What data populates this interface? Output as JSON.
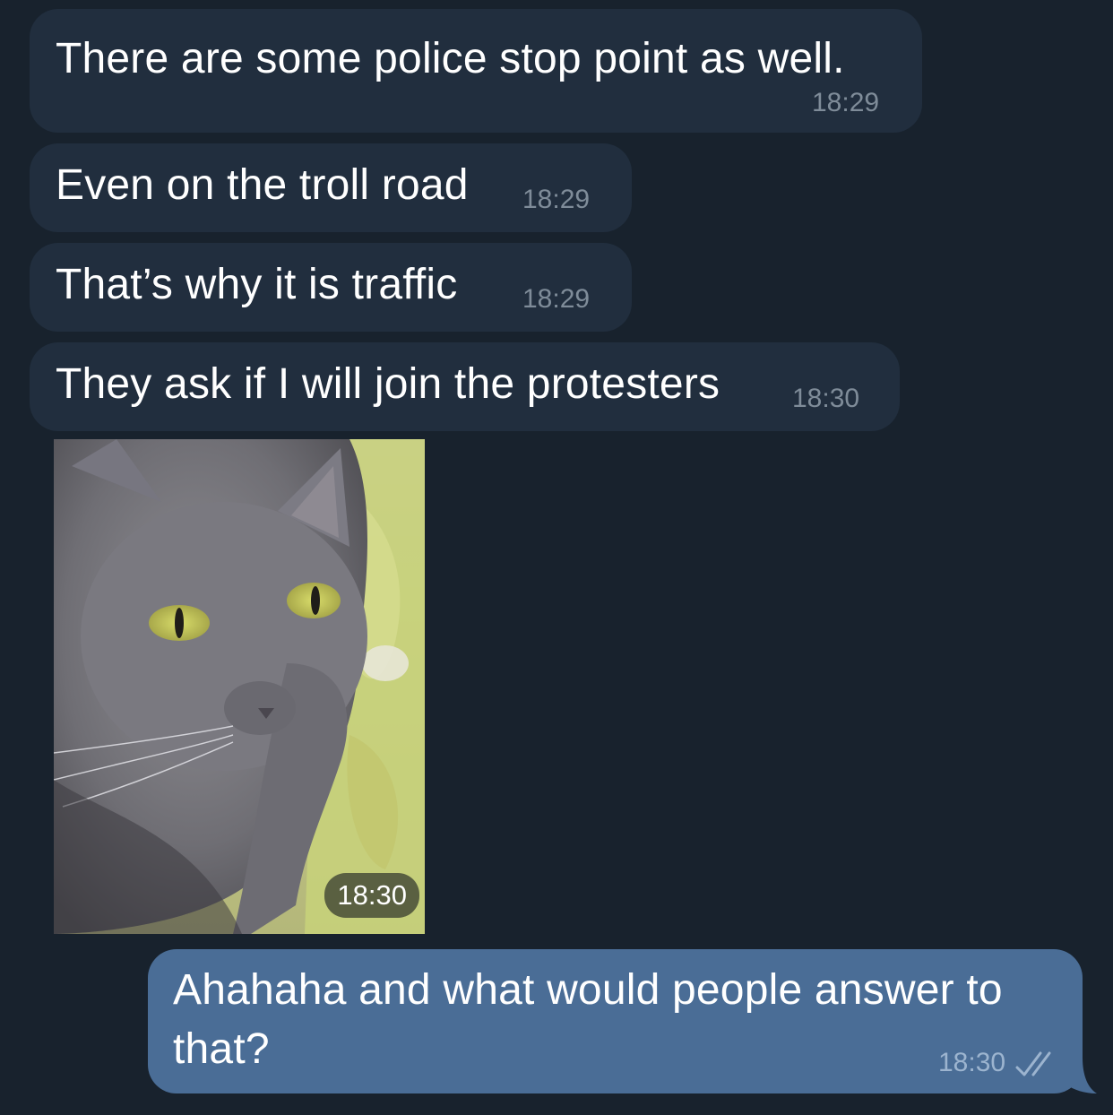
{
  "messages": [
    {
      "text": "There are some police stop point as well.",
      "time": "18:29"
    },
    {
      "text": "Even on the troll road",
      "time": "18:29"
    },
    {
      "text": "That’s why it is traffic",
      "time": "18:29"
    },
    {
      "text": "They ask if I will join the protesters",
      "time": "18:30"
    }
  ],
  "photo": {
    "icon": "cat-photo",
    "time": "18:30"
  },
  "outgoing": {
    "line1": "Ahahaha and what would people answer to",
    "line2": "that?",
    "time": "18:30",
    "status_icon": "double-check-icon"
  },
  "colors": {
    "background": "#18222d",
    "incoming_bubble": "#212e3e",
    "outgoing_bubble": "#4a6d96"
  }
}
